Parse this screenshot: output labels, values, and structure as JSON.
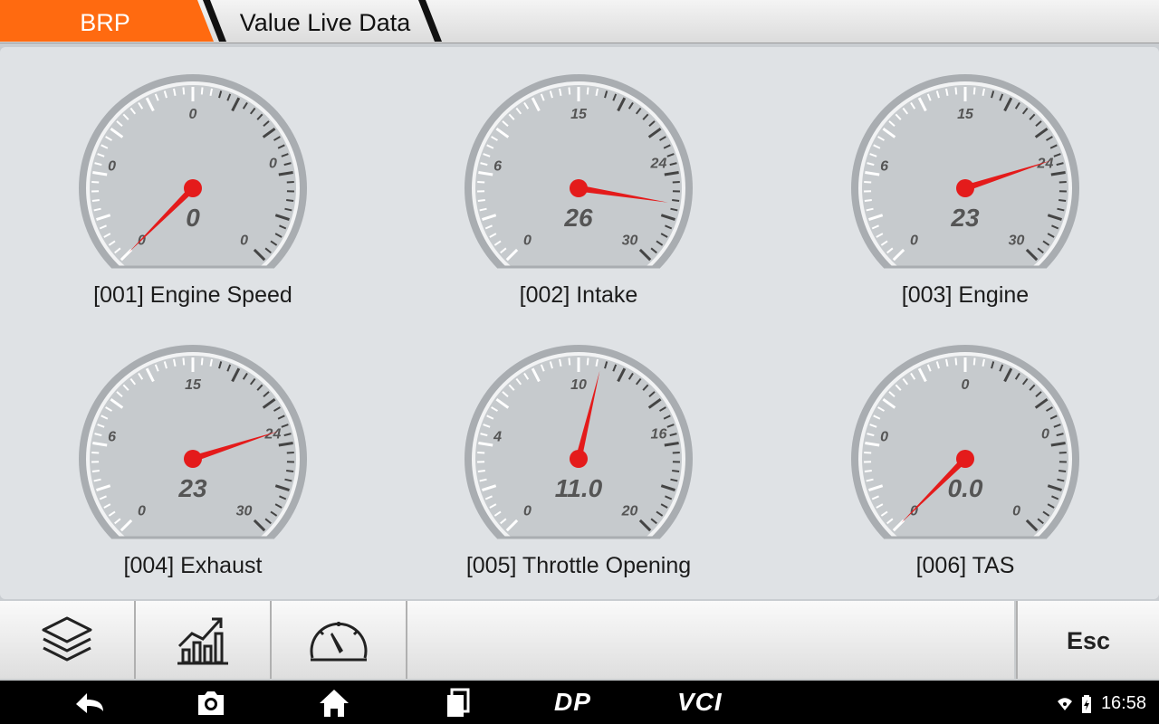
{
  "header": {
    "crumb_active": "BRP",
    "crumb_current": "Value Live Data",
    "accent_color": "#ff6a10"
  },
  "gauges": [
    {
      "label": "[001] Engine Speed",
      "value": "0",
      "ticks": {
        "left_low": "0",
        "left_mid": "0",
        "top": "0",
        "right_mid": "0",
        "right_low": "0"
      },
      "needle_fraction": 0.0
    },
    {
      "label": "[002] Intake",
      "value": "26",
      "ticks": {
        "left_low": "0",
        "left_mid": "6",
        "top": "15",
        "right_mid": "24",
        "right_low": "30"
      },
      "needle_fraction": 0.867
    },
    {
      "label": "[003] Engine",
      "value": "23",
      "ticks": {
        "left_low": "0",
        "left_mid": "6",
        "top": "15",
        "right_mid": "24",
        "right_low": "30"
      },
      "needle_fraction": 0.767
    },
    {
      "label": "[004] Exhaust",
      "value": "23",
      "ticks": {
        "left_low": "0",
        "left_mid": "6",
        "top": "15",
        "right_mid": "24",
        "right_low": "30"
      },
      "needle_fraction": 0.767
    },
    {
      "label": "[005] Throttle Opening",
      "value": "11.0",
      "ticks": {
        "left_low": "0",
        "left_mid": "4",
        "top": "10",
        "right_mid": "16",
        "right_low": "20"
      },
      "needle_fraction": 0.55
    },
    {
      "label": "[006] TAS",
      "value": "0.0",
      "ticks": {
        "left_low": "0",
        "left_mid": "0",
        "top": "0",
        "right_mid": "0",
        "right_low": "0"
      },
      "needle_fraction": 0.0
    }
  ],
  "toolbar": {
    "buttons": [
      {
        "icon": "layers-icon"
      },
      {
        "icon": "chart-icon"
      },
      {
        "icon": "gauge-icon"
      }
    ],
    "esc_label": "Esc"
  },
  "navbar": {
    "icons": [
      "back-icon",
      "camera-icon",
      "home-icon",
      "recents-icon"
    ],
    "dp_label": "DP",
    "vci_label": "VCI",
    "time": "16:58"
  }
}
